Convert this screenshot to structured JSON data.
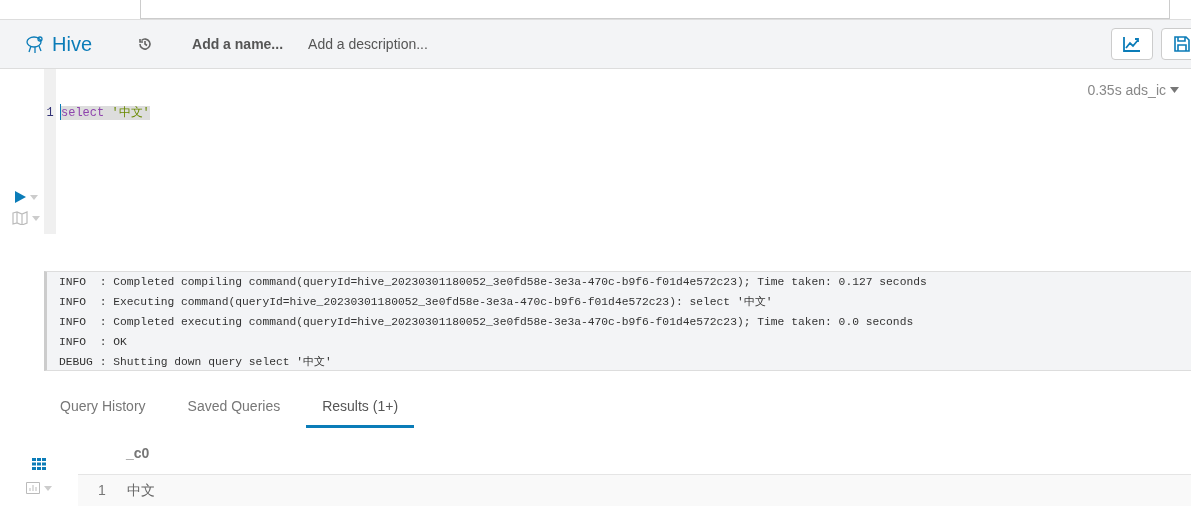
{
  "header": {
    "app_name": "Hive",
    "name_placeholder": "Add a name...",
    "description_placeholder": "Add a description..."
  },
  "editor": {
    "status": "0.35s ads_ic",
    "lines": [
      {
        "number": "1",
        "tokens": [
          {
            "kind": "keyword",
            "text": "select"
          },
          {
            "kind": "string",
            "text": "'中文'"
          }
        ]
      }
    ]
  },
  "log": [
    "INFO  : Completed compiling command(queryId=hive_20230301180052_3e0fd58e-3e3a-470c-b9f6-f01d4e572c23); Time taken: 0.127 seconds",
    "INFO  : Executing command(queryId=hive_20230301180052_3e0fd58e-3e3a-470c-b9f6-f01d4e572c23): select '中文'",
    "INFO  : Completed executing command(queryId=hive_20230301180052_3e0fd58e-3e3a-470c-b9f6-f01d4e572c23); Time taken: 0.0 seconds",
    "INFO  : OK",
    "DEBUG : Shutting down query select '中文'"
  ],
  "result_tabs": [
    {
      "label": "Query History",
      "selected": false
    },
    {
      "label": "Saved Queries",
      "selected": false
    },
    {
      "label": "Results (1+)",
      "selected": true
    }
  ],
  "results": {
    "columns": [
      "_c0"
    ],
    "rows": [
      {
        "number": "1",
        "cells": [
          "中文"
        ]
      }
    ]
  }
}
